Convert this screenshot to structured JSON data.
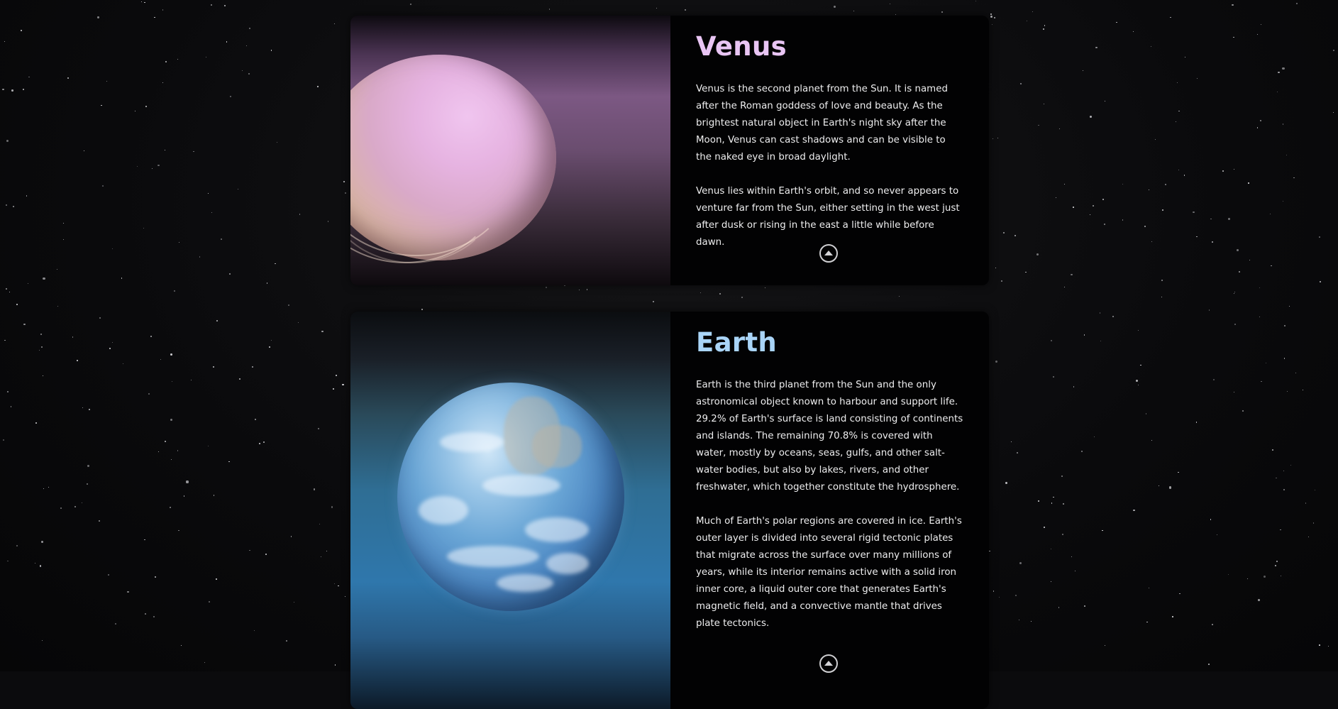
{
  "planets": [
    {
      "name": "Venus",
      "title_color": "#e9c5f4",
      "paragraphs": [
        "Venus is the second planet from the Sun. It is named after the Roman goddess of love and beauty. As the brightest natural object in Earth's night sky after the Moon, Venus can cast shadows and can be visible to the naked eye in broad daylight.",
        "Venus lies within Earth's orbit, and so never appears to venture far from the Sun, either setting in the west just after dusk or rising in the east a little while before dawn."
      ],
      "scroll_top_icon": "chevron-up-circle-icon"
    },
    {
      "name": "Earth",
      "title_color": "#a9d4f7",
      "paragraphs": [
        "Earth is the third planet from the Sun and the only astronomical object known to harbour and support life. 29.2% of Earth's surface is land consisting of continents and islands. The remaining 70.8% is covered with water, mostly by oceans, seas, gulfs, and other salt-water bodies, but also by lakes, rivers, and other freshwater, which together constitute the hydrosphere.",
        "Much of Earth's polar regions are covered in ice. Earth's outer layer is divided into several rigid tectonic plates that migrate across the surface over many millions of years, while its interior remains active with a solid iron inner core, a liquid outer core that generates Earth's magnetic field, and a convective mantle that drives plate tectonics."
      ],
      "scroll_top_icon": "chevron-up-circle-icon"
    }
  ],
  "colors": {
    "background": "#0b0b0d",
    "card": "#020203",
    "text": "#eeeeef"
  }
}
